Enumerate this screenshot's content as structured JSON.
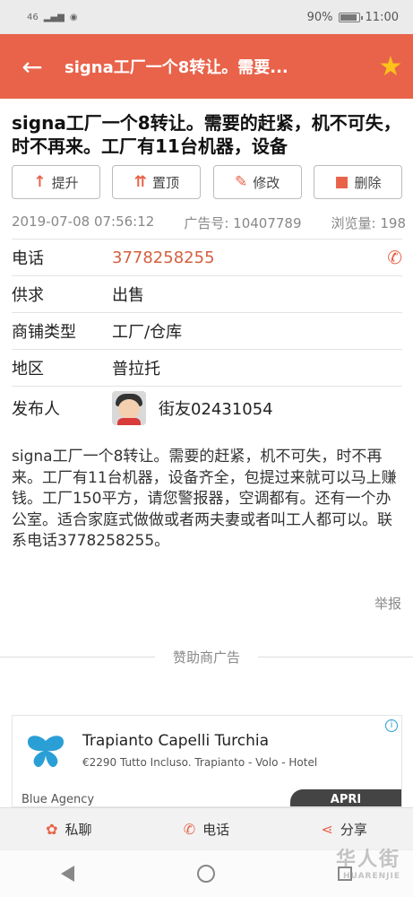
{
  "status_bar": {
    "network": "46",
    "battery": "90%",
    "battery_level": 0.9,
    "time": "11:00"
  },
  "appbar": {
    "title": "signa工厂一个8转让。需要..."
  },
  "headline": "signa工厂一个8转让。需要的赶紧，机不可失，时不再来。工厂有11台机器，设备",
  "actions": {
    "promote": "提升",
    "pin": "置顶",
    "edit": "修改",
    "delete": "删除"
  },
  "meta": {
    "datetime": "2019-07-08 07:56:12",
    "ad_no": "广告号: 10407789",
    "views": "浏览量: 198"
  },
  "fields": {
    "phone_label": "电话",
    "phone_value": "3778258255",
    "supply_label": "供求",
    "supply_value": "出售",
    "type_label": "商铺类型",
    "type_value": "工厂/仓库",
    "region_label": "地区",
    "region_value": "普拉托",
    "poster_label": "发布人",
    "poster_value": "街友02431054"
  },
  "description": "signa工厂一个8转让。需要的赶紧，机不可失，时不再来。工厂有11台机器，设备齐全，包提过来就可以马上赚钱。工厂150平方，请您警报器，空调都有。还有一个办公室。适合家庭式做做或者两夫妻或者叫工人都可以。联系电话3778258255。",
  "report": "举报",
  "sponsor_label": "赞助商广告",
  "ad": {
    "title": "Trapianto Capelli Turchia",
    "subtitle": "€2290 Tutto Incluso. Trapianto - Volo - Hotel",
    "agency": "Blue Agency",
    "cta": "APRI",
    "info": "i",
    "logo_color": "#2a9fd6"
  },
  "bottom_bar": {
    "chat": "私聊",
    "call": "电话",
    "share": "分享"
  },
  "watermark": {
    "main": "华人街",
    "sub": "HUARENJIE"
  },
  "colors": {
    "accent": "#e8634a",
    "star": "#ffc21a",
    "phone": "#d4603f"
  }
}
